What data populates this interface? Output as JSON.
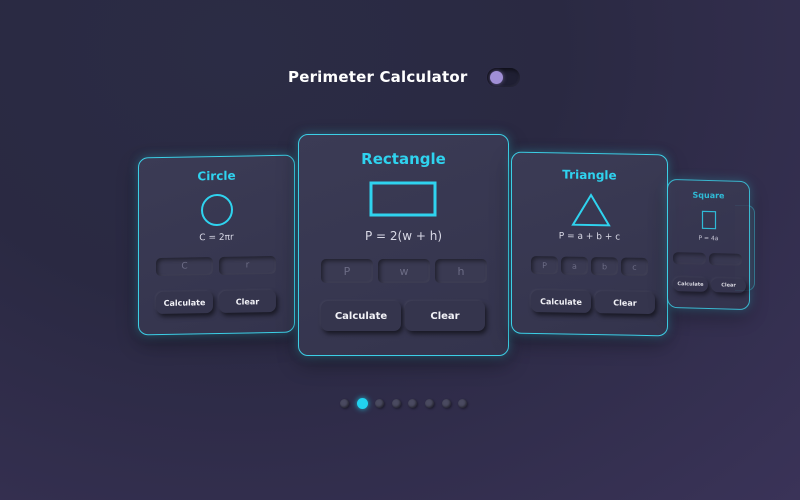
{
  "header": {
    "title": "Perimeter Calculator",
    "toggle_state": "off"
  },
  "cards": {
    "circle": {
      "title": "Circle",
      "formula": "C = 2πr",
      "shape_icon": "circle-icon",
      "inputs": [
        {
          "placeholder": "C"
        },
        {
          "placeholder": "r"
        }
      ],
      "calculate_label": "Calculate",
      "clear_label": "Clear"
    },
    "rectangle": {
      "title": "Rectangle",
      "formula": "P = 2(w + h)",
      "shape_icon": "rectangle-icon",
      "inputs": [
        {
          "placeholder": "P"
        },
        {
          "placeholder": "w"
        },
        {
          "placeholder": "h"
        }
      ],
      "calculate_label": "Calculate",
      "clear_label": "Clear"
    },
    "triangle": {
      "title": "Triangle",
      "formula": "P = a + b + c",
      "shape_icon": "triangle-icon",
      "inputs": [
        {
          "placeholder": "P"
        },
        {
          "placeholder": "a"
        },
        {
          "placeholder": "b"
        },
        {
          "placeholder": "c"
        }
      ],
      "calculate_label": "Calculate",
      "clear_label": "Clear"
    },
    "square": {
      "title": "Square",
      "formula": "P = 4a",
      "shape_icon": "square-icon",
      "inputs": [
        {
          "placeholder": ""
        },
        {
          "placeholder": ""
        }
      ],
      "calculate_label": "Calculate",
      "clear_label": "Clear"
    }
  },
  "pagination": {
    "total": 8,
    "active_index": 1
  },
  "colors": {
    "accent": "#2fd3ef",
    "toggle_knob": "#a08fd6",
    "background": "#2b2a44"
  }
}
